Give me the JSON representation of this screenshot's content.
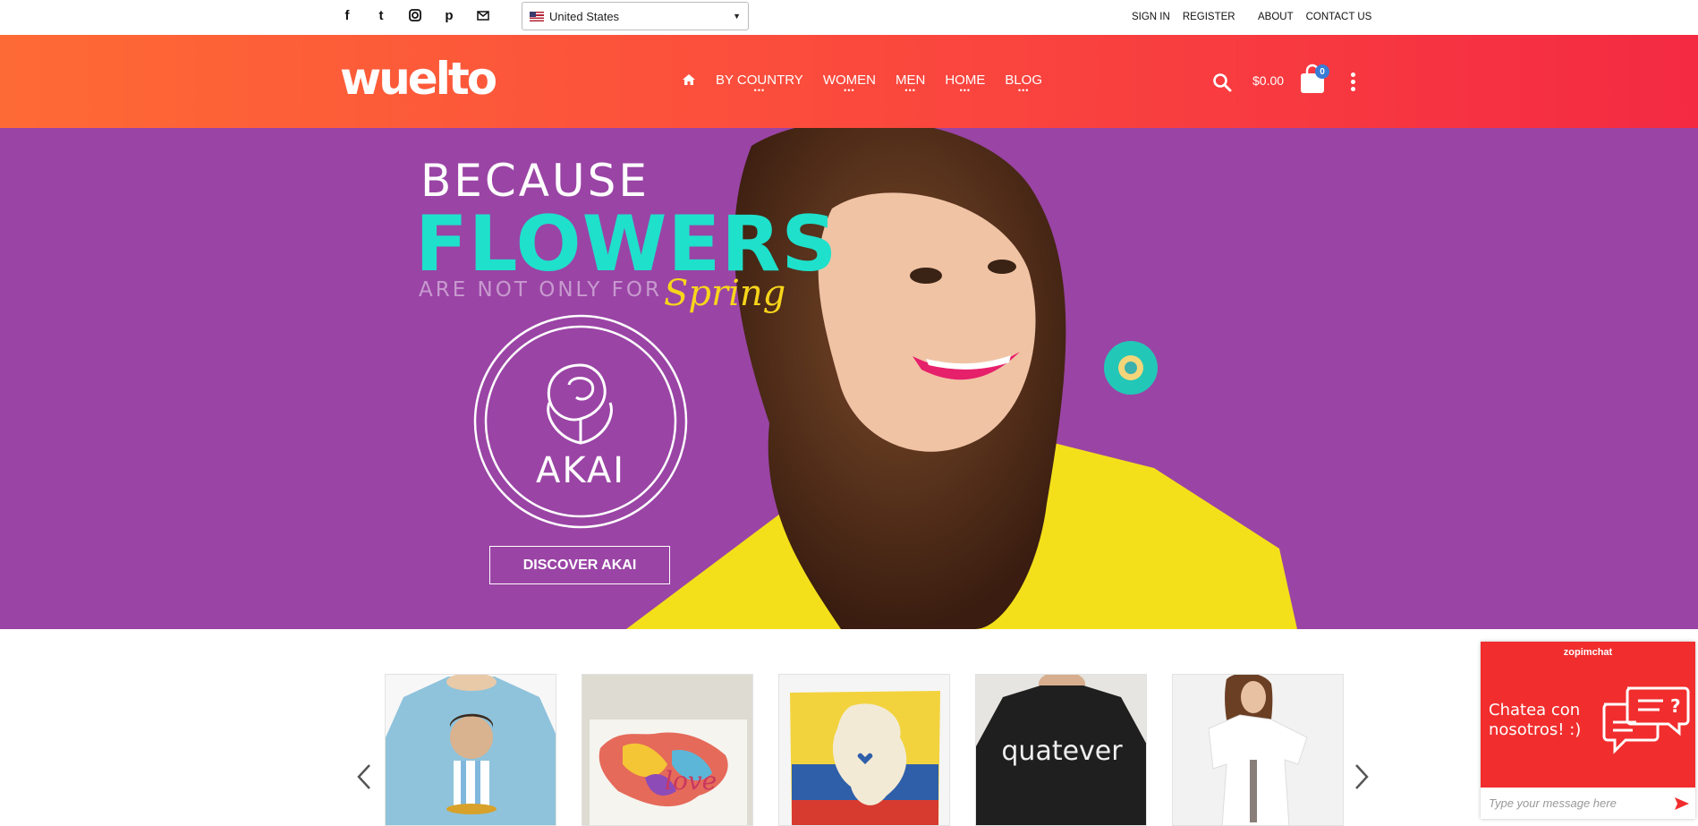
{
  "topbar": {
    "social_icons": [
      "facebook-icon",
      "twitter-icon",
      "instagram-icon",
      "pinterest-icon",
      "mail-icon"
    ],
    "country_select": {
      "value": "United States",
      "flag": "us-flag-icon"
    },
    "links_left": [
      "SIGN IN",
      "REGISTER"
    ],
    "links_right": [
      "ABOUT",
      "CONTACT US"
    ]
  },
  "header": {
    "logo": "wuelto",
    "nav": [
      "BY COUNTRY",
      "WOMEN",
      "MEN",
      "HOME",
      "BLOG"
    ],
    "cart_total": "$0.00",
    "cart_count": "0",
    "gradient": [
      "#fe6a35",
      "#f42a43"
    ]
  },
  "hero": {
    "line1": "BECAUSE",
    "line2": "FLOWERS",
    "line3": "ARE NOT ONLY FOR",
    "line4": "Spring",
    "brand": "AKAI",
    "cta": "DISCOVER AKAI",
    "colors": {
      "background": "#9a45a6",
      "accent": "#1ee0cb",
      "script": "#f7d51b"
    }
  },
  "carousel": {
    "products": [
      {
        "name": "product-soccer-tshirt",
        "bg": "#8fc3dc"
      },
      {
        "name": "product-venezuela-love-print",
        "bg": "#e8e6e1"
      },
      {
        "name": "product-colombia-pillow",
        "bg": "#f2d33d"
      },
      {
        "name": "product-quatever-tshirt",
        "bg": "#222222"
      },
      {
        "name": "product-white-tshirt",
        "bg": "#f4f4f4"
      }
    ],
    "quatever_text": "quatever"
  },
  "chat": {
    "brand": "zopimchat",
    "message": "Chatea con nosotros! :)",
    "placeholder": "Type your message here",
    "color": "#f12d2d"
  }
}
